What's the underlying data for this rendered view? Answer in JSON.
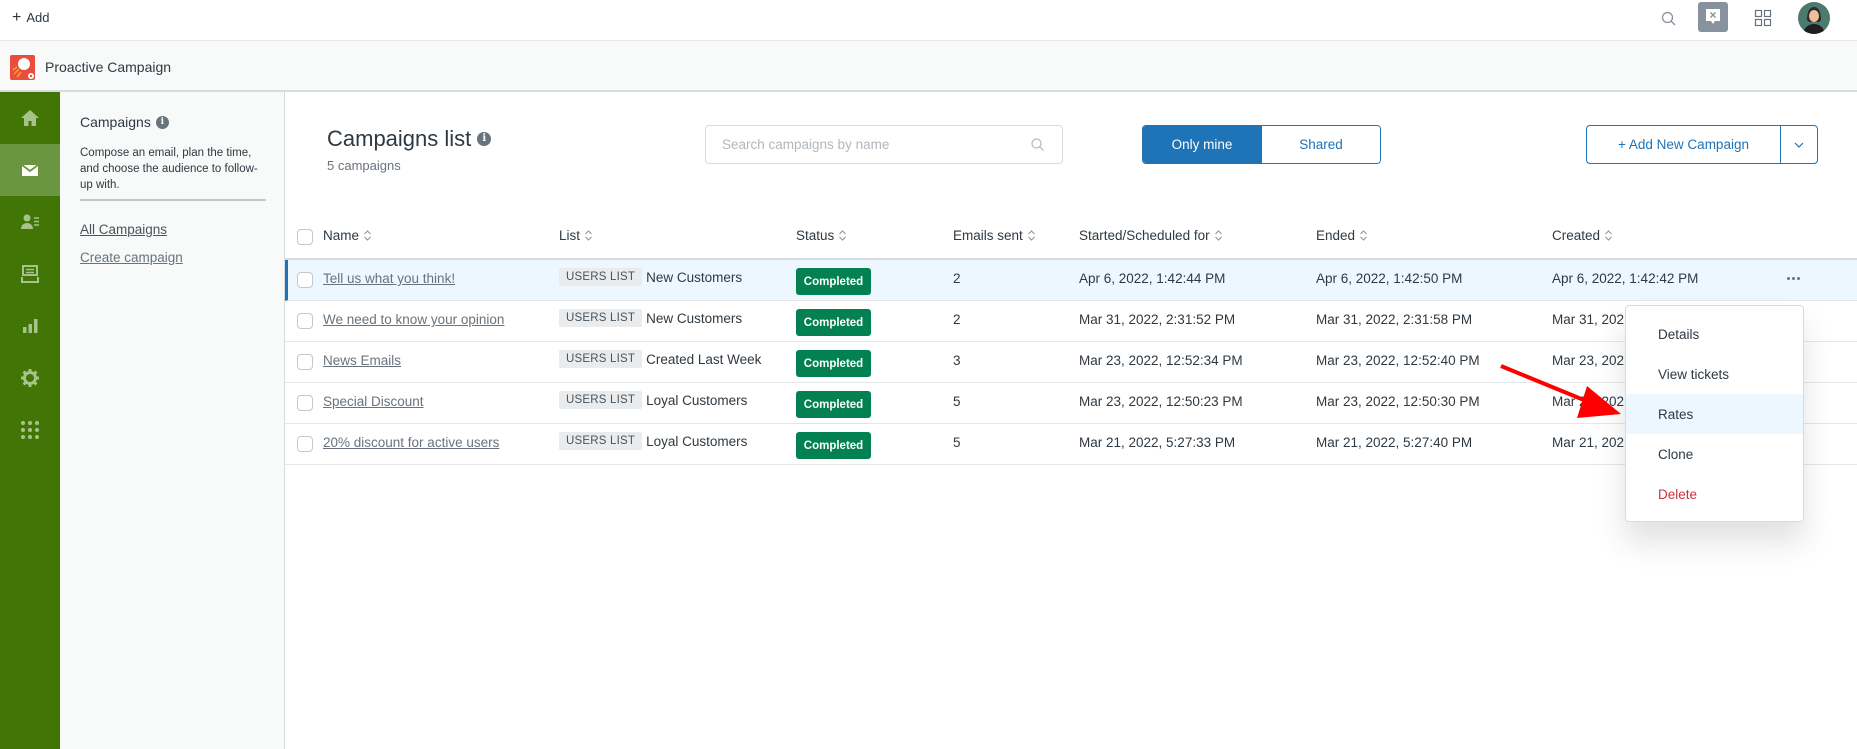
{
  "topbar": {
    "add_label": "Add",
    "icons": [
      "search-icon",
      "chat-close-icon",
      "product-grid-icon",
      "avatar"
    ]
  },
  "module": {
    "title": "Proactive Campaign"
  },
  "leftnav": {
    "items": [
      {
        "icon": "home-icon",
        "active": false
      },
      {
        "icon": "mail-icon",
        "active": true
      },
      {
        "icon": "contacts-icon",
        "active": false
      },
      {
        "icon": "inbox-icon",
        "active": false
      },
      {
        "icon": "reports-icon",
        "active": false
      },
      {
        "icon": "settings-icon",
        "active": false
      },
      {
        "icon": "apps-icon",
        "active": false
      }
    ]
  },
  "subnav": {
    "title": "Campaigns",
    "description": "Compose an email, plan the time, and choose the audience to follow-up with.",
    "links": [
      {
        "label": "All Campaigns",
        "active": true
      },
      {
        "label": "Create campaign",
        "active": false
      }
    ]
  },
  "main": {
    "title": "Campaigns list",
    "subtitle": "5 campaigns",
    "search": {
      "placeholder": "Search campaigns by name",
      "value": ""
    },
    "filter": {
      "options": [
        "Only mine",
        "Shared"
      ],
      "selected": "Only mine"
    },
    "add_button": "+ Add New Campaign"
  },
  "table": {
    "columns": [
      "Name",
      "List",
      "Status",
      "Emails sent",
      "Started/Scheduled for",
      "Ended",
      "Created"
    ],
    "rows": [
      {
        "name": "Tell us what you think!",
        "list_tag": "USERS LIST",
        "list": "New Customers",
        "status": "Completed",
        "emails_sent": "2",
        "started": "Apr 6, 2022, 1:42:44 PM",
        "ended": "Apr 6, 2022, 1:42:50 PM",
        "created": "Apr 6, 2022, 1:42:42 PM"
      },
      {
        "name": "We need to know your opinion",
        "list_tag": "USERS LIST",
        "list": "New Customers",
        "status": "Completed",
        "emails_sent": "2",
        "started": "Mar 31, 2022, 2:31:52 PM",
        "ended": "Mar 31, 2022, 2:31:58 PM",
        "created": "Mar 31, 202"
      },
      {
        "name": "News Emails",
        "list_tag": "USERS LIST",
        "list": "Created Last Week",
        "status": "Completed",
        "emails_sent": "3",
        "started": "Mar 23, 2022, 12:52:34 PM",
        "ended": "Mar 23, 2022, 12:52:40 PM",
        "created": "Mar 23, 202"
      },
      {
        "name": "Special Discount",
        "list_tag": "USERS LIST",
        "list": "Loyal Customers",
        "status": "Completed",
        "emails_sent": "5",
        "started": "Mar 23, 2022, 12:50:23 PM",
        "ended": "Mar 23, 2022, 12:50:30 PM",
        "created": "Mar 23, 202"
      },
      {
        "name": "20% discount for active users",
        "list_tag": "USERS LIST",
        "list": "Loyal Customers",
        "status": "Completed",
        "emails_sent": "5",
        "started": "Mar 21, 2022, 5:27:33 PM",
        "ended": "Mar 21, 2022, 5:27:40 PM",
        "created": "Mar 21, 202"
      }
    ]
  },
  "context_menu": {
    "items": [
      {
        "label": "Details"
      },
      {
        "label": "View tickets"
      },
      {
        "label": "Rates",
        "highlighted": true
      },
      {
        "label": "Clone"
      },
      {
        "label": "Delete",
        "danger": true
      }
    ]
  },
  "colors": {
    "nav_green": "#417505",
    "primary_blue": "#1f73b7",
    "status_green": "#038153",
    "danger_red": "#cc3340",
    "annotation_red": "#ff0000"
  }
}
